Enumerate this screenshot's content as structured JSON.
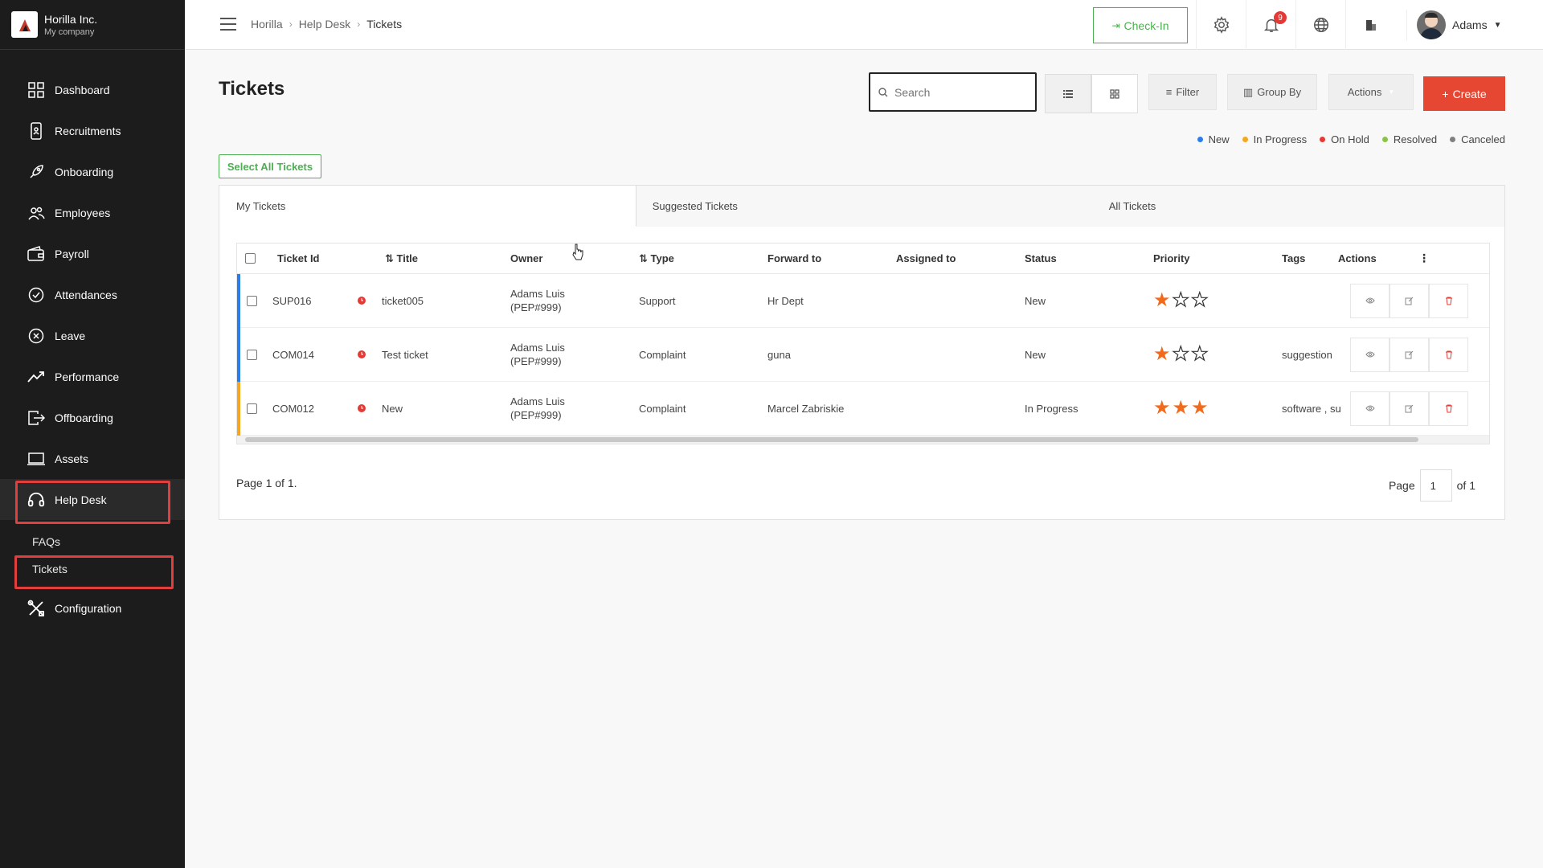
{
  "brand": {
    "name": "Horilla Inc.",
    "company": "My company"
  },
  "sidebar": {
    "items": [
      {
        "label": "Dashboard",
        "icon": "dashboard-grid-icon"
      },
      {
        "label": "Recruitments",
        "icon": "recruitment-icon"
      },
      {
        "label": "Onboarding",
        "icon": "rocket-icon"
      },
      {
        "label": "Employees",
        "icon": "people-icon"
      },
      {
        "label": "Payroll",
        "icon": "wallet-icon"
      },
      {
        "label": "Attendances",
        "icon": "check-circle-icon"
      },
      {
        "label": "Leave",
        "icon": "x-circle-icon"
      },
      {
        "label": "Performance",
        "icon": "trend-icon"
      },
      {
        "label": "Offboarding",
        "icon": "exit-icon"
      },
      {
        "label": "Assets",
        "icon": "laptop-icon"
      },
      {
        "label": "Help Desk",
        "icon": "headset-icon"
      }
    ],
    "sub_items": [
      {
        "label": "FAQs"
      },
      {
        "label": "Tickets"
      }
    ],
    "config": {
      "label": "Configuration",
      "icon": "tools-icon"
    },
    "highlight_color": "#e33e3e"
  },
  "topbar": {
    "breadcrumbs": [
      "Horilla",
      "Help Desk",
      "Tickets"
    ],
    "checkin_label": "Check-In",
    "notification_count": "9",
    "user_name": "Adams"
  },
  "main": {
    "title": "Tickets",
    "search_placeholder": "Search",
    "filter_label": "Filter",
    "group_by_label": "Group By",
    "actions_label": "Actions",
    "create_label": "Create",
    "select_all_label": "Select All Tickets",
    "legend": [
      {
        "label": "New",
        "color": "#2b7de9"
      },
      {
        "label": "In Progress",
        "color": "#f5a623"
      },
      {
        "label": "On Hold",
        "color": "#e53935"
      },
      {
        "label": "Resolved",
        "color": "#8bc34a"
      },
      {
        "label": "Canceled",
        "color": "#808080"
      }
    ],
    "tabs": [
      "My Tickets",
      "Suggested Tickets",
      "All Tickets"
    ],
    "columns": [
      "Ticket Id",
      "Title",
      "Owner",
      "Type",
      "Forward to",
      "Assigned to",
      "Status",
      "Priority",
      "Tags",
      "Actions"
    ],
    "rows": [
      {
        "id": "SUP016",
        "title": "ticket005",
        "owner": "Adams Luis",
        "owner_code": "(PEP#999)",
        "type": "Support",
        "forward_to": "Hr Dept",
        "assigned_to": "",
        "status": "New",
        "priority": 1,
        "tags": "",
        "status_color": "#2b7de9"
      },
      {
        "id": "COM014",
        "title": "Test ticket",
        "owner": "Adams Luis",
        "owner_code": "(PEP#999)",
        "type": "Complaint",
        "forward_to": "guna",
        "assigned_to": "",
        "status": "New",
        "priority": 1,
        "tags": "suggestion",
        "status_color": "#2b7de9"
      },
      {
        "id": "COM012",
        "title": "New",
        "owner": "Adams Luis",
        "owner_code": "(PEP#999)",
        "type": "Complaint",
        "forward_to": "Marcel Zabriskie",
        "assigned_to": "",
        "status": "In Progress",
        "priority": 3,
        "tags": "software , su",
        "status_color": "#f5a623"
      }
    ],
    "page_text": "Page 1 of 1.",
    "pager": {
      "label": "Page",
      "current": "1",
      "of_label": "of 1"
    }
  }
}
